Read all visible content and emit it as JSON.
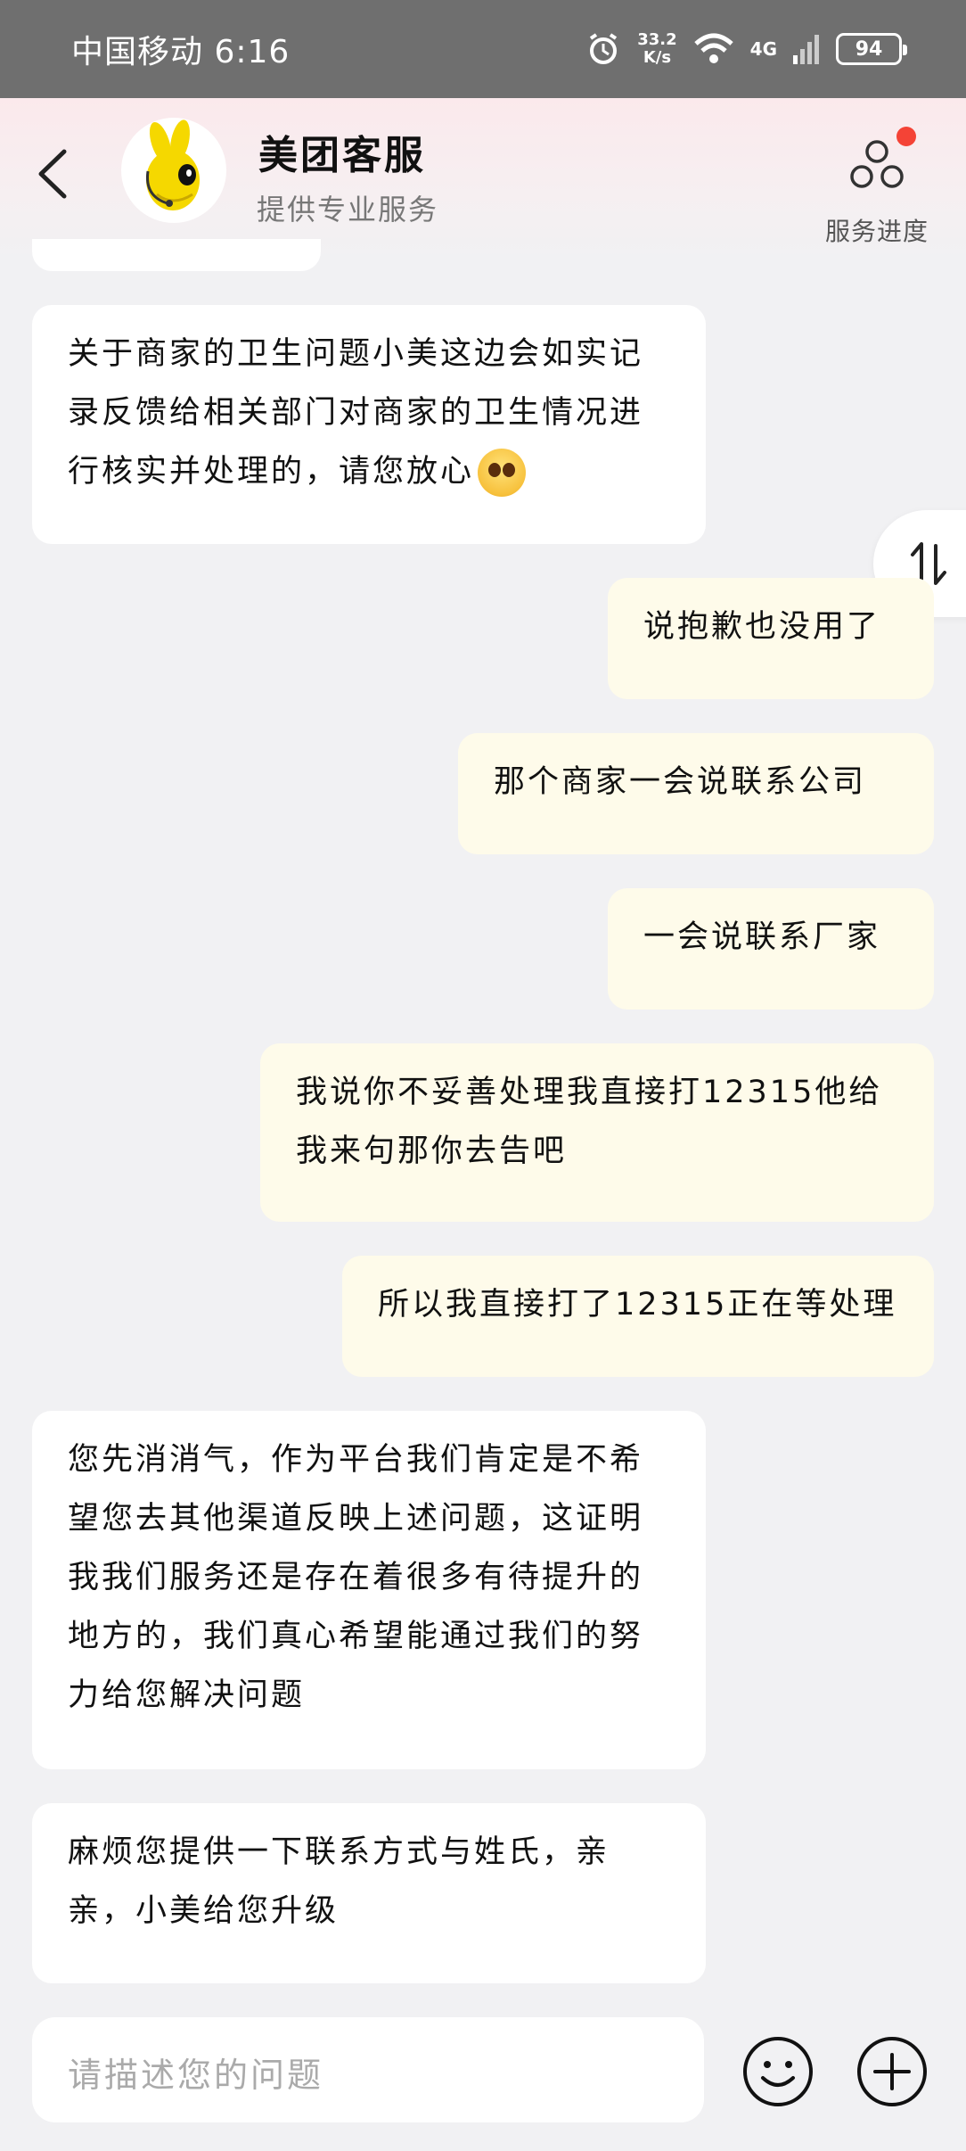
{
  "status_bar": {
    "carrier_time": "中国移动 6:16",
    "speed_value": "33.2",
    "speed_unit": "K/s",
    "network": "4G",
    "battery": "94"
  },
  "header": {
    "title": "美团客服",
    "subtitle": "提供专业服务",
    "progress_label": "服务进度"
  },
  "messages": [
    {
      "side": "left",
      "text": "关于商家的卫生问题小美这边会如实记录反馈给相关部门对商家的卫生情况进行核实并处理的，请您放心"
    },
    {
      "side": "right",
      "text": "说抱歉也没用了"
    },
    {
      "side": "right",
      "text": "那个商家一会说联系公司"
    },
    {
      "side": "right",
      "text": "一会说联系厂家"
    },
    {
      "side": "right",
      "text": "我说你不妥善处理我直接打12315他给我来句那你去告吧"
    },
    {
      "side": "right",
      "text": "所以我直接打了12315正在等处理"
    },
    {
      "side": "left",
      "text": "您先消消气，作为平台我们肯定是不希望您去其他渠道反映上述问题，这证明我我们服务还是存在着很多有待提升的地方的，我们真心希望能通过我们的努力给您解决问题"
    },
    {
      "side": "left",
      "text": "麻烦您提供一下联系方式与姓氏，亲亲，小美给您升级"
    }
  ],
  "input": {
    "placeholder": "请描述您的问题"
  },
  "icons": {
    "back": "back-chevron-icon",
    "progress": "service-progress-icon",
    "sort": "sort-arrows-icon",
    "emoji": "smiley-icon",
    "plus": "plus-icon"
  },
  "colors": {
    "status_bar": "#6f6f6f",
    "bubble_left": "#ffffff",
    "bubble_right": "#fefbea",
    "background": "#f1f1f3",
    "badge": "#f44336"
  }
}
